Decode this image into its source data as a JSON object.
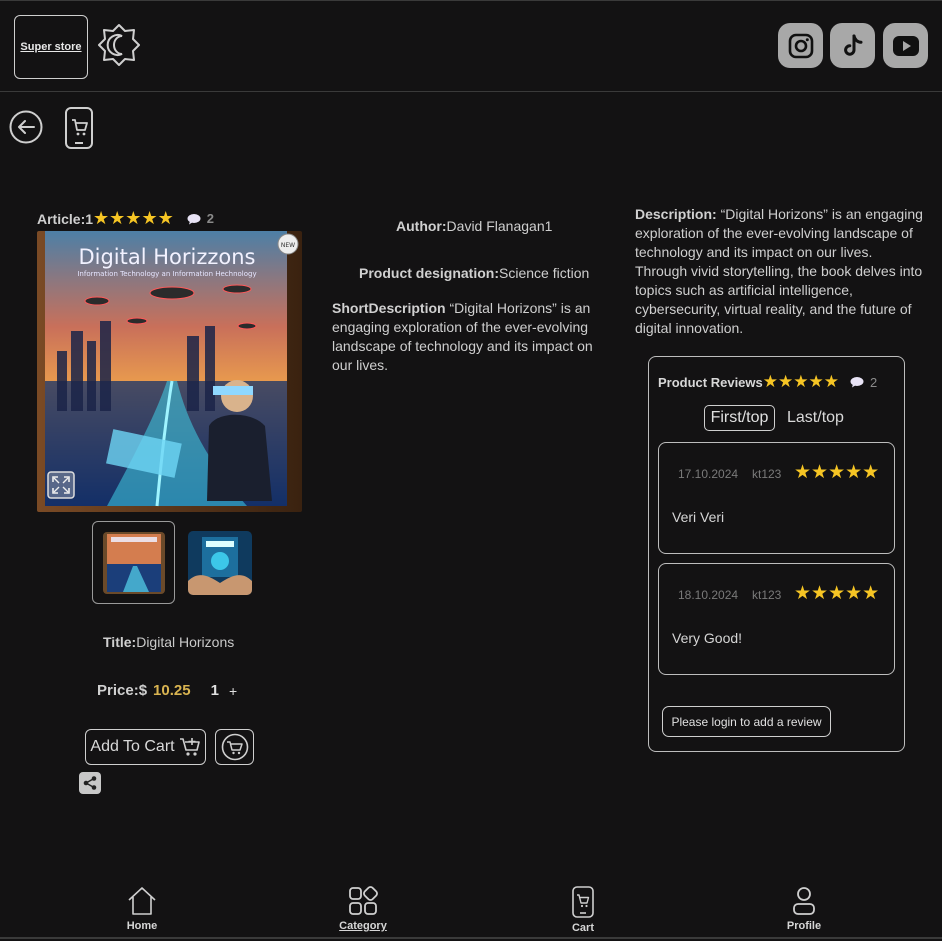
{
  "header": {
    "logo_text": "Super store",
    "social": [
      "instagram-icon",
      "tiktok-icon",
      "youtube-icon"
    ]
  },
  "product": {
    "article_label": "Article:",
    "article_value": "1",
    "rating_stars": "★★★★★",
    "rating": 5,
    "comment_count": "2",
    "cover_title": "Digital Horizzons",
    "cover_subtitle": "Information Technology an Information Hechnology",
    "cover_badge": "NEW",
    "title_label": "Title:",
    "title_value": "Digital Horizons",
    "price_label": "Price:$",
    "price_value": "10.25",
    "quantity": "1",
    "plus": "+",
    "add_to_cart": "Add To Cart",
    "author_label": "Author:",
    "author_value": "David Flanagan1",
    "designation_label": "Product designation:",
    "designation_value": "Science fiction",
    "short_label": "ShortDescription",
    "short_value": " “Digital Horizons” is an engaging exploration of the ever-evolving landscape of technology and its impact on our lives.",
    "description_label": "Description:",
    "description_value": " “Digital Horizons” is an engaging exploration of the ever-evolving landscape of technology and its impact on our lives. Through vivid storytelling, the book delves into topics such as artificial intelligence, cybersecurity, virtual reality, and the future of digital innovation."
  },
  "reviews": {
    "heading": "Product Reviews",
    "stars": "★★★★★",
    "count": "2",
    "sort_first": "First/top",
    "sort_last": "Last/top",
    "items": [
      {
        "date": "17.10.2024",
        "user": "kt123",
        "stars": "★★★★★",
        "rating": 5,
        "text": "Veri Veri"
      },
      {
        "date": "18.10.2024",
        "user": "kt123",
        "stars": "★★★★★",
        "rating": 5,
        "text": "Very Good!"
      }
    ],
    "login_prompt": "Please login to add a review"
  },
  "nav": {
    "home": "Home",
    "category": "Category",
    "cart": "Cart",
    "profile": "Profile",
    "active": "category"
  },
  "colors": {
    "background": "#131213",
    "star": "#f6c524",
    "price": "#d9b451"
  }
}
